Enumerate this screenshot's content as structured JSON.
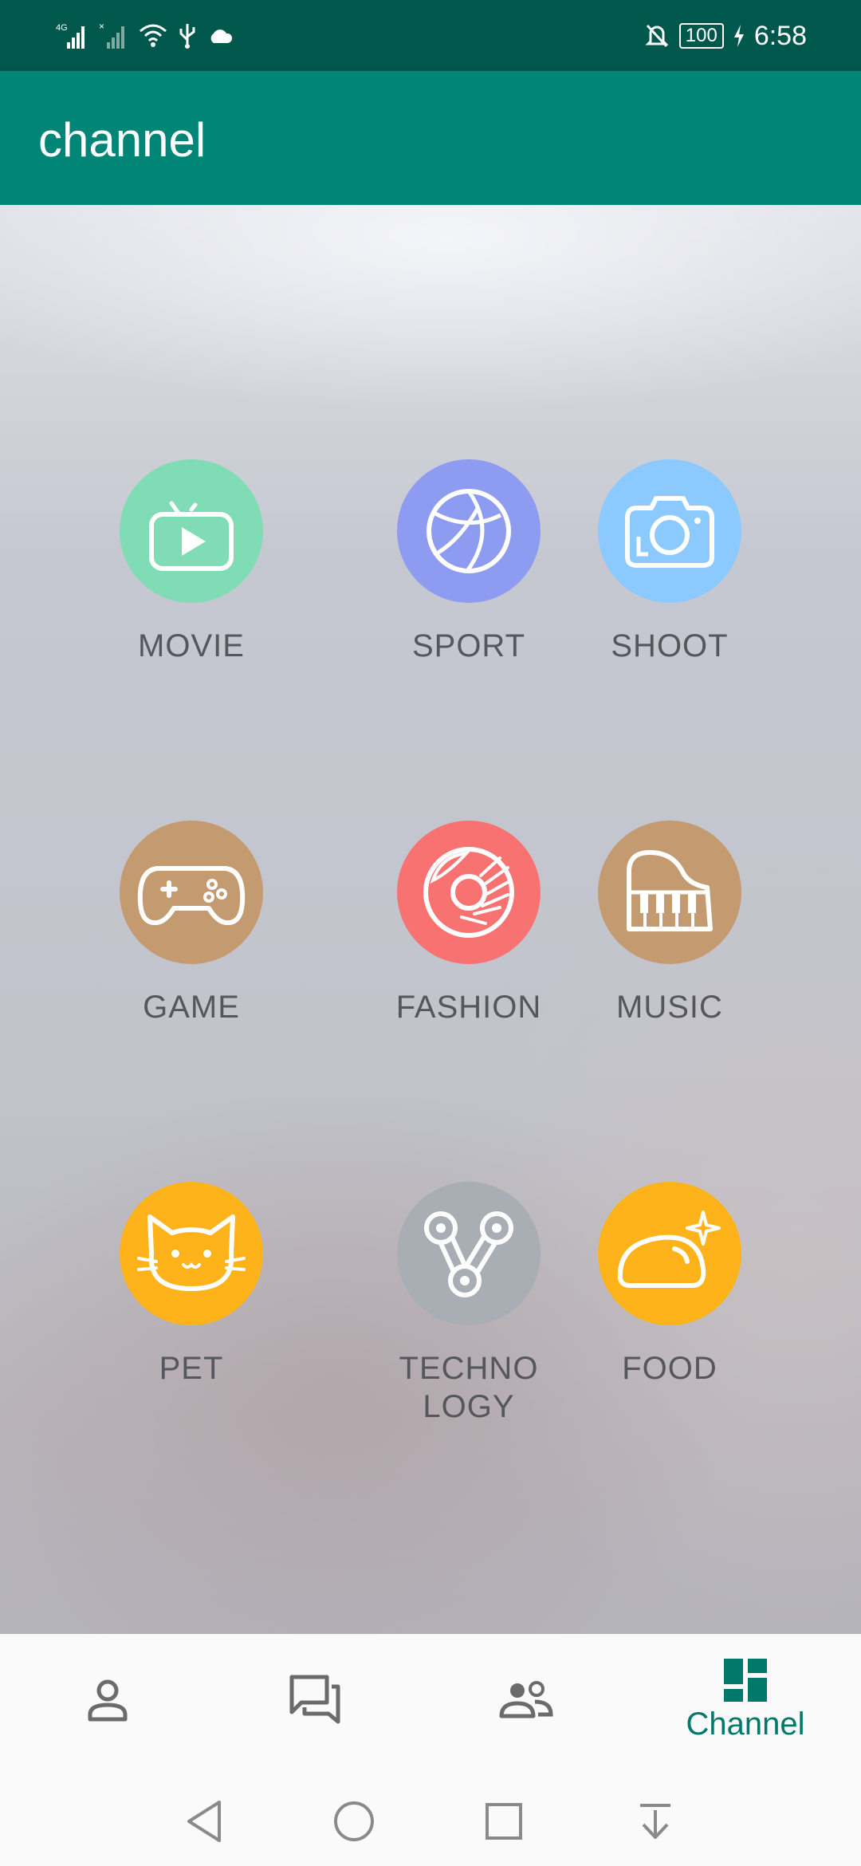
{
  "status_bar": {
    "network_label": "4G",
    "battery": "100",
    "time": "6:58"
  },
  "app_bar": {
    "title": "channel"
  },
  "channels": [
    {
      "label": "MOVIE",
      "icon": "tv-play-icon",
      "color": "#7fdcb5"
    },
    {
      "label": "SPORT",
      "icon": "ball-icon",
      "color": "#8d9bf0"
    },
    {
      "label": "SHOOT",
      "icon": "camera-icon",
      "color": "#8cc9ff"
    },
    {
      "label": "GAME",
      "icon": "gamepad-icon",
      "color": "#c49a70"
    },
    {
      "label": "FASHION",
      "icon": "donut-icon",
      "color": "#f97272"
    },
    {
      "label": "MUSIC",
      "icon": "piano-icon",
      "color": "#c49a70"
    },
    {
      "label": "PET",
      "icon": "cat-icon",
      "color": "#ffb31a"
    },
    {
      "label": "TECHNO\nLOGY",
      "icon": "nodes-icon",
      "color": "#a9aeb4"
    },
    {
      "label": "FOOD",
      "icon": "bread-icon",
      "color": "#ffb31a"
    }
  ],
  "bottom_nav": {
    "items": [
      {
        "name": "profile",
        "icon": "person-icon",
        "label": ""
      },
      {
        "name": "messages",
        "icon": "chat-icon",
        "label": ""
      },
      {
        "name": "contacts",
        "icon": "people-icon",
        "label": ""
      },
      {
        "name": "channel",
        "icon": "dashboard-icon",
        "label": "Channel",
        "active": true
      }
    ],
    "active_color": "#00796b",
    "inactive_color": "#6b6b6b"
  },
  "system_nav": [
    "back-icon",
    "home-icon",
    "recents-icon",
    "notification-pull-icon"
  ]
}
